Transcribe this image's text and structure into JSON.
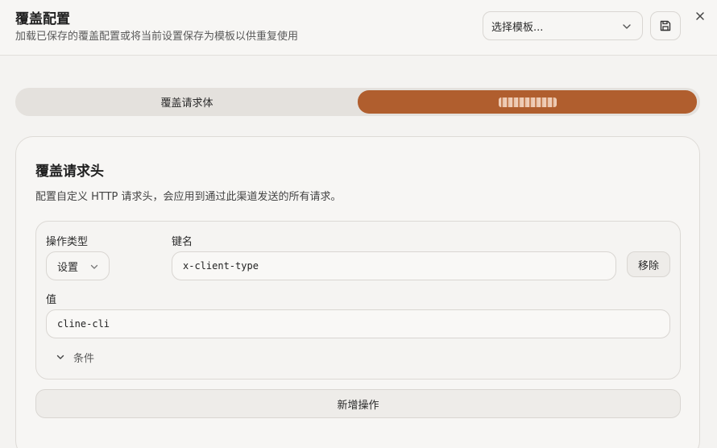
{
  "header": {
    "title": "覆盖配置",
    "subtitle": "加载已保存的覆盖配置或将当前设置保存为模板以供重复使用",
    "template_select": {
      "placeholder": "选择模板..."
    },
    "save_icon": "save-icon",
    "close_icon": "close-icon"
  },
  "tabs": [
    {
      "label": "覆盖请求体",
      "active": false
    },
    {
      "label": "",
      "active": true
    }
  ],
  "section": {
    "title": "覆盖请求头",
    "description": "配置自定义 HTTP 请求头，会应用到通过此渠道发送的所有请求。"
  },
  "operation": {
    "type_label": "操作类型",
    "type_value": "设置",
    "key_label": "键名",
    "key_value": "x-client-type",
    "remove_label": "移除",
    "value_label": "值",
    "value_value": "cline-cli",
    "conditions_label": "条件"
  },
  "add_operation_label": "新增操作",
  "colors": {
    "accent": "#b05e2e",
    "background": "#f4f3f1"
  }
}
